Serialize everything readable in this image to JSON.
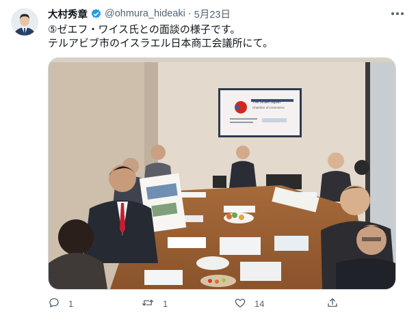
{
  "user": {
    "name": "大村秀章",
    "handle": "@ohmura_hideaki",
    "separator": "·",
    "date": "5月23日"
  },
  "tweet": {
    "line1": "⑤ゼエフ・ワイス氏との面談の様子です。",
    "line2": "テルアビブ市のイスラエル日本商工会議所にて。"
  },
  "screen_slide": {
    "title": "The Israel-Japan",
    "subtitle": "Chamber of Commerce"
  },
  "actions": {
    "reply_count": "1",
    "retweet_count": "1",
    "like_count": "14"
  },
  "colors": {
    "text": "#0f1419",
    "secondary": "#536471",
    "verified": "#1d9bf0",
    "border": "#cfd9de"
  },
  "icons": [
    "more-icon",
    "verified-icon",
    "reply-icon",
    "retweet-icon",
    "like-icon",
    "share-icon"
  ]
}
